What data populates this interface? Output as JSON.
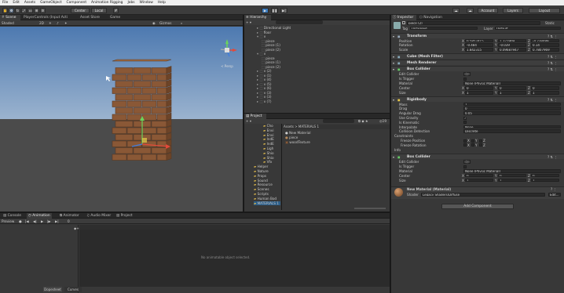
{
  "menu": [
    "File",
    "Edit",
    "Assets",
    "GameObject",
    "Component",
    "Animation Rigging",
    "Jobs",
    "Window",
    "Help"
  ],
  "toolbar": {
    "center": "Center",
    "local": "Local",
    "account": "Account",
    "layers": "Layers",
    "layout": "Layout"
  },
  "scene": {
    "tabs": [
      "Scene",
      "PlayerControls (Input Acti",
      "Asset Store",
      "Game"
    ],
    "shading": "Shaded",
    "mode_2d": "2D",
    "gizmos": "Gizmos",
    "persp": "< Persp"
  },
  "hierarchy": {
    "tab": "Hierarchy",
    "items": [
      "Directional Light",
      "floor",
      "v",
      "piece",
      "piece (1)",
      "piece (2)",
      "v",
      "piece",
      "piece (1)",
      "piece (2)",
      "v (2)",
      "v (1)",
      "v (4)",
      "v (5)",
      "v (6)",
      "v (3)",
      "v (3)",
      "v (7)"
    ]
  },
  "project": {
    "tab": "Project",
    "breadcrumb": "Assets > MATERIALS 1",
    "folders": [
      "Cho",
      "Envi",
      "Envi",
      "IndE",
      "IndE",
      "Ligh",
      "Shio",
      "Shio",
      "Vfx",
      "Helper",
      "Nature",
      "Props",
      "Sound",
      "Resource",
      "Scenes",
      "Scripts",
      "Human Bod",
      "MATERIALS 1"
    ],
    "files": [
      "New Material",
      "piece",
      "woodTexture"
    ]
  },
  "console": {
    "tabs": [
      "Console",
      "Animation",
      "Animator",
      "Audio Mixer",
      "Project"
    ],
    "preview": "Preview",
    "frame": "0",
    "message": "No animatable object selected.",
    "bottom_tabs": [
      "Dopesheet",
      "Curves"
    ]
  },
  "inspector": {
    "tabs": [
      "Inspector",
      "Navigation"
    ],
    "name": "piece (2)",
    "static": "Static",
    "tag_label": "Tag",
    "tag": "Untagged",
    "layer_label": "Layer",
    "layer": "Default",
    "transform": {
      "title": "Transform",
      "rows": [
        {
          "label": "Position",
          "x": "0.5852415",
          "y": "1.327909",
          "z": "-4.238489"
        },
        {
          "label": "Rotation",
          "x": "-0.484",
          "y": "-0.039",
          "z": "0.14"
        },
        {
          "label": "Scale",
          "x": "1.842315",
          "y": "0.09687947",
          "z": "0.7807969"
        }
      ]
    },
    "mesh_filter": "Cube (Mesh Filter)",
    "mesh_renderer": "Mesh Renderer",
    "box_collider_1": {
      "title": "Box Collider",
      "edit_collider": "Edit Collider",
      "is_trigger": "Is Trigger",
      "material": "Material",
      "material_value": "None (Physic Material)",
      "center": {
        "label": "Center",
        "x": "0",
        "y": "0",
        "z": "0"
      },
      "size": {
        "label": "Size",
        "x": "1",
        "y": "1",
        "z": "1"
      }
    },
    "rigidbody": {
      "title": "Rigidbody",
      "rows": [
        {
          "label": "Mass",
          "value": "1"
        },
        {
          "label": "Drag",
          "value": "0"
        },
        {
          "label": "Angular Drag",
          "value": "0.05"
        },
        {
          "label": "Use Gravity",
          "value": "✓"
        },
        {
          "label": "Is Kinematic",
          "value": ""
        },
        {
          "label": "Interpolate",
          "value": "None"
        },
        {
          "label": "Collision Detection",
          "value": "Discrete"
        }
      ],
      "constraints": "Constraints",
      "freeze_position": "Freeze Position",
      "freeze_rotation": "Freeze Rotation",
      "axes": [
        "X",
        "Y",
        "Z"
      ],
      "info": "Info"
    },
    "box_collider_2": {
      "title": "Box Collider",
      "edit_collider": "Edit Collider",
      "is_trigger": "Is Trigger",
      "material": "Material",
      "material_value": "None (Physic Material)",
      "center": {
        "label": "Center",
        "x": "0",
        "y": "0",
        "z": "0"
      },
      "size": {
        "label": "Size",
        "x": "1",
        "y": "1",
        "z": "1"
      }
    },
    "material": {
      "name": "New Material (Material)",
      "shader_label": "Shader",
      "shader": "Legacy Shaders/Diffuse",
      "edit": "Edit..."
    },
    "add_component": "Add Component"
  },
  "colors": {
    "accent": "#3a79bb",
    "wood": "#8a5a36",
    "sky": "#5b86b8",
    "ground": "#4a4a4a"
  }
}
